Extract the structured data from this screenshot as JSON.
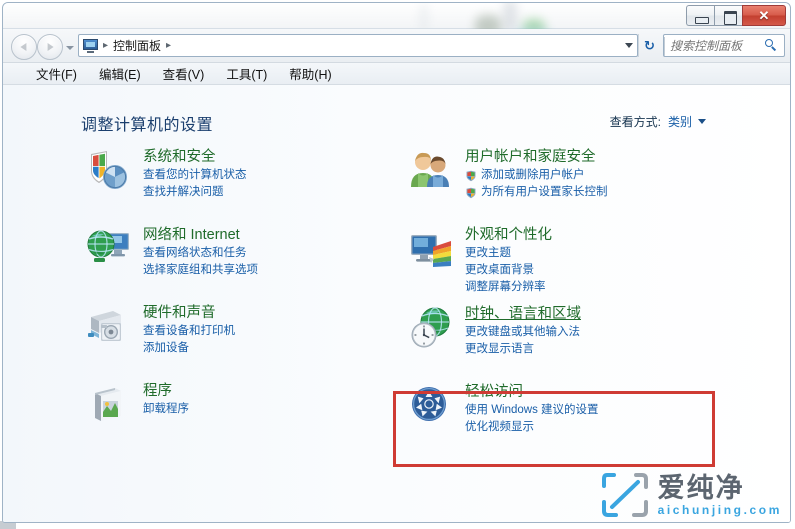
{
  "window": {
    "buttons": {
      "minimize": "minimize",
      "maximize": "maximize",
      "close": "✕"
    }
  },
  "navbar": {
    "breadcrumb": {
      "root_icon": "control-panel-icon",
      "items": [
        "控制面板"
      ],
      "separator": "▸"
    },
    "refresh_glyph": "↻",
    "search": {
      "placeholder": "搜索控制面板",
      "value": ""
    }
  },
  "menubar": {
    "items": [
      "文件(F)",
      "编辑(E)",
      "查看(V)",
      "工具(T)",
      "帮助(H)"
    ]
  },
  "content": {
    "page_title": "调整计算机的设置",
    "view_by": {
      "label": "查看方式:",
      "value": "类别"
    },
    "left_column": [
      {
        "icon": "shield-security-icon",
        "title": "系统和安全",
        "links": [
          "查看您的计算机状态",
          "查找并解决问题"
        ]
      },
      {
        "icon": "network-globe-icon",
        "title": "网络和 Internet",
        "links": [
          "查看网络状态和任务",
          "选择家庭组和共享选项"
        ]
      },
      {
        "icon": "printer-speaker-icon",
        "title": "硬件和声音",
        "links": [
          "查看设备和打印机",
          "添加设备"
        ]
      },
      {
        "icon": "programs-box-icon",
        "title": "程序",
        "links": [
          "卸载程序"
        ]
      }
    ],
    "right_column": [
      {
        "icon": "user-accounts-icon",
        "title": "用户帐户和家庭安全",
        "links": [
          "添加或删除用户帐户",
          "为所有用户设置家长控制"
        ],
        "link_icons": [
          "shield-icon",
          "shield-icon"
        ]
      },
      {
        "icon": "appearance-monitor-icon",
        "title": "外观和个性化",
        "links": [
          "更改主题",
          "更改桌面背景",
          "调整屏幕分辨率"
        ]
      },
      {
        "icon": "clock-globe-icon",
        "title": "时钟、语言和区域",
        "highlighted": true,
        "links": [
          "更改键盘或其他输入法",
          "更改显示语言"
        ]
      },
      {
        "icon": "ease-of-access-icon",
        "title": "轻松访问",
        "links": [
          "使用 Windows 建议的设置",
          "优化视频显示"
        ]
      }
    ]
  },
  "highlight": {
    "color": "#cf3b34",
    "target": "时钟、语言和区域"
  },
  "watermark": {
    "cn": "爱纯净",
    "en": "aichunjing.com",
    "accent": "#3aa5e0"
  }
}
